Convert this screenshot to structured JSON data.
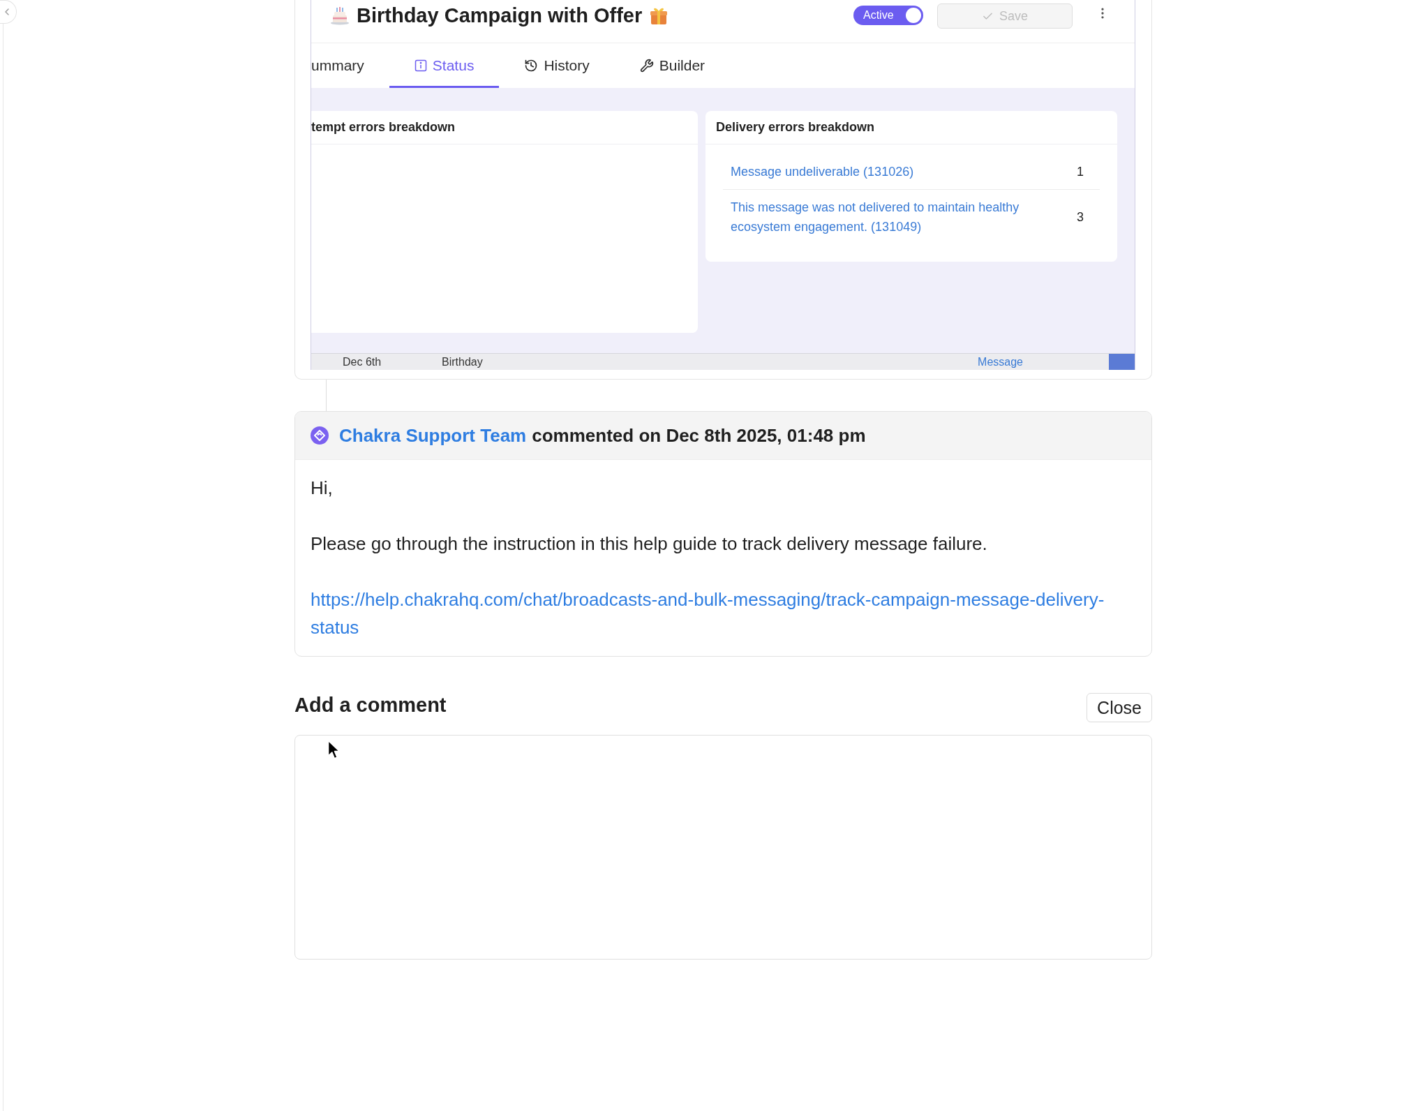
{
  "campaign_window": {
    "title": "Birthday Campaign with Offer",
    "status_toggle": {
      "label": "Active",
      "on": true
    },
    "save_button": {
      "label": "Save",
      "disabled": true
    },
    "tabs": [
      {
        "label": "ummary",
        "selected": false
      },
      {
        "label": "Status",
        "selected": true
      },
      {
        "label": "History",
        "selected": false
      },
      {
        "label": "Builder",
        "selected": false
      }
    ],
    "panels": [
      {
        "title": "tempt errors breakdown"
      },
      {
        "title": "Delivery errors breakdown",
        "rows": [
          {
            "label": "Message undeliverable (131026)",
            "count": "1"
          },
          {
            "label": "This message was not delivered to maintain healthy ecosystem engagement. (131049)",
            "count": "3"
          }
        ]
      }
    ],
    "table_row": {
      "cells": [
        {
          "text": "Dec 6th",
          "kind": "text"
        },
        {
          "text": "Birthday",
          "kind": "text"
        },
        {
          "text": "Message",
          "kind": "link"
        }
      ]
    }
  },
  "comment": {
    "author": "Chakra Support Team",
    "meta": "commented on Dec 8th 2025, 01:48 pm",
    "paragraphs": [
      "Hi,",
      "Please go through the instruction in this help guide to track delivery message failure."
    ],
    "link": "https://help.chakrahq.com/chat/broadcasts-and-bulk-messaging/track-campaign-message-delivery-status"
  },
  "add_comment": {
    "heading": "Add a comment",
    "close_button": {
      "label": "Close"
    }
  }
}
